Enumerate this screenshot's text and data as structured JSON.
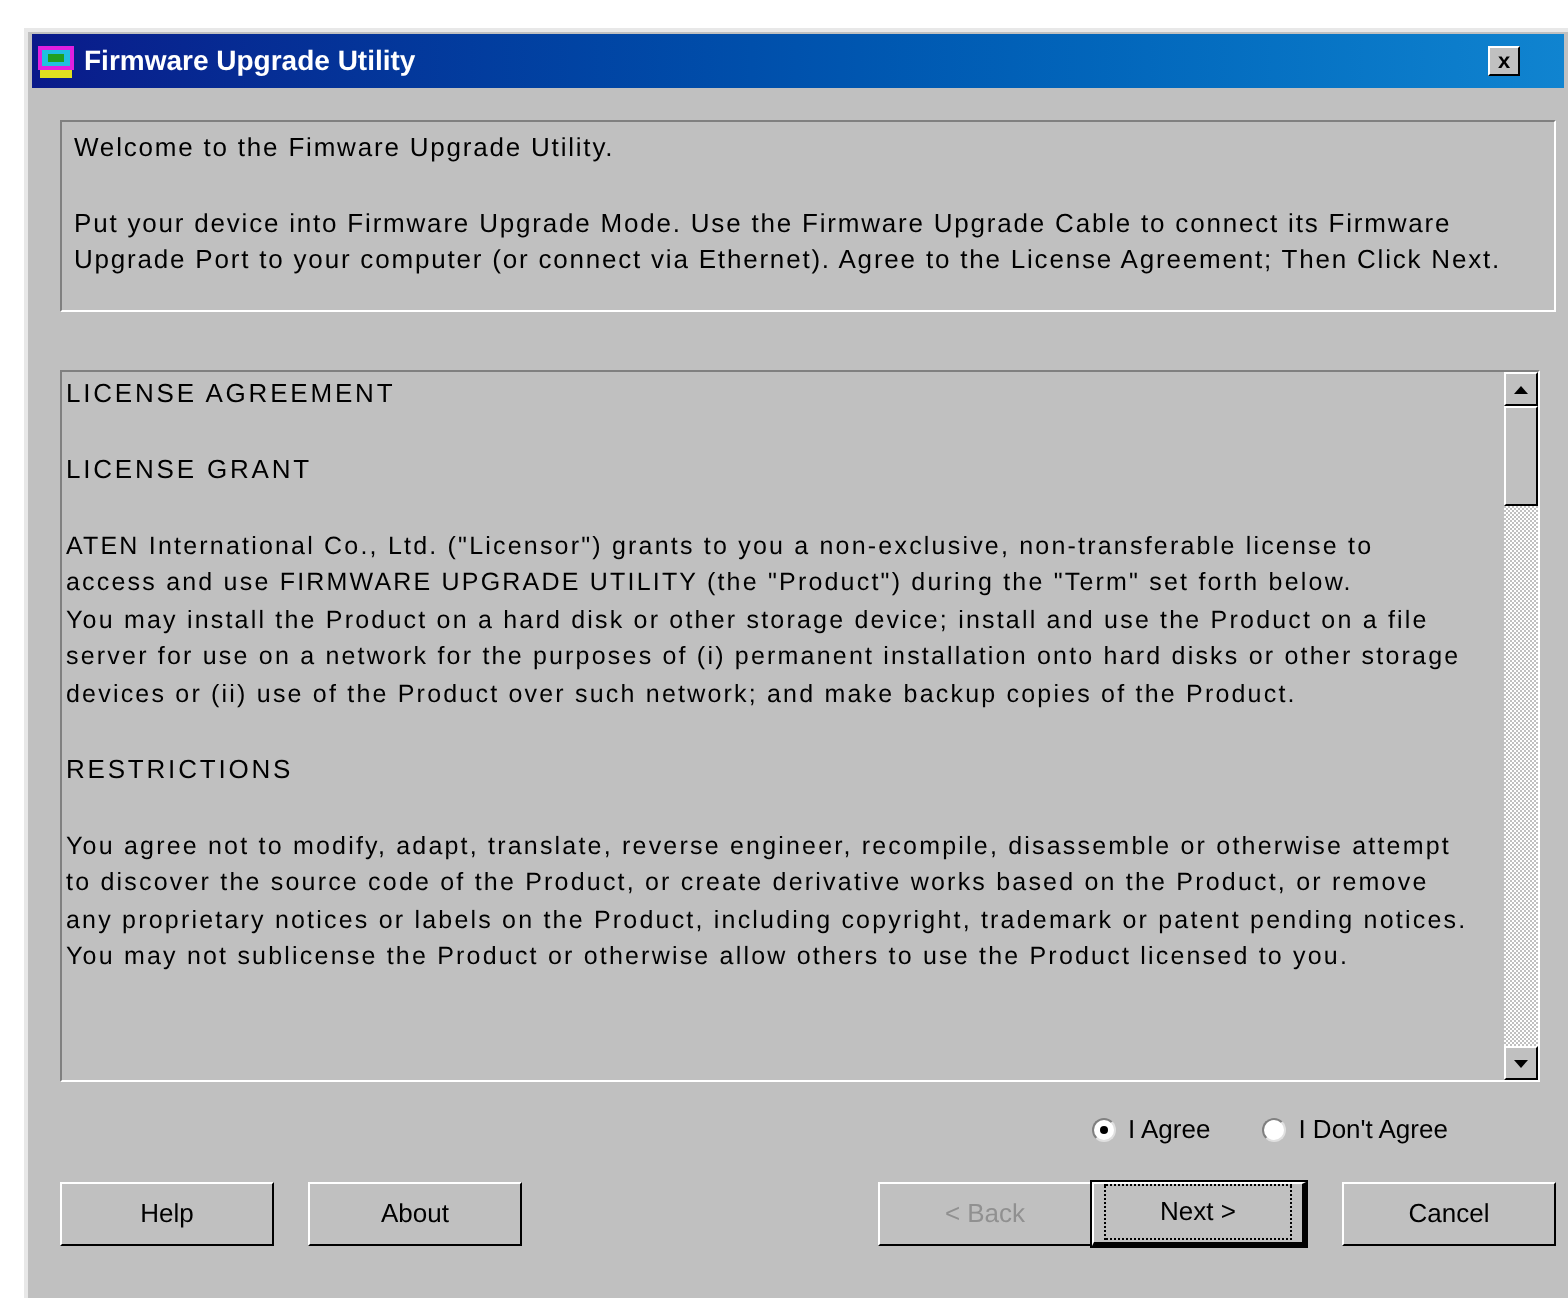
{
  "window": {
    "title": "Firmware Upgrade Utility",
    "close": "x"
  },
  "intro": {
    "paragraphs": [
      {
        "lines": [
          "Welcome to the Fimware Upgrade Utility."
        ]
      },
      {
        "lines": [
          "Put your device into Firmware Upgrade Mode. Use the Firmware Upgrade Cable to connect its Firmware",
          "Upgrade Port to your computer (or connect via Ethernet). Agree to the License Agreement; Then Click Next."
        ]
      }
    ]
  },
  "license": {
    "blocks": [
      {
        "kind": "heading",
        "lines": [
          "LICENSE AGREEMENT"
        ]
      },
      {
        "kind": "heading",
        "lines": [
          "LICENSE GRANT"
        ]
      },
      {
        "kind": "paragraph",
        "lines": [
          "ATEN International Co., Ltd. (\"Licensor\") grants to you a non-exclusive, non-transferable license to",
          "access and use FIRMWARE UPGRADE UTILITY (the \"Product\") during the \"Term\" set forth below.",
          "You may install the Product on a hard disk or other storage device; install and use the Product on a file",
          "server for use on a network for the purposes of (i) permanent installation onto hard disks or other storage",
          "devices or (ii) use of the Product over such network; and make backup copies of the Product."
        ]
      },
      {
        "kind": "heading",
        "lines": [
          "RESTRICTIONS"
        ]
      },
      {
        "kind": "paragraph",
        "lines": [
          "You agree not to modify, adapt, translate, reverse engineer, recompile, disassemble or otherwise attempt",
          "to discover the source code of the Product, or create derivative works based on the Product, or remove",
          "any proprietary notices or labels on the Product, including copyright, trademark or patent pending notices.",
          "You may not sublicense the Product or otherwise allow others to use the Product licensed to you."
        ]
      }
    ]
  },
  "agreement": [
    {
      "label": "I Agree",
      "selected": true
    },
    {
      "label": "I Don't Agree",
      "selected": false
    }
  ],
  "buttons_left": [
    {
      "label": "Help",
      "disabled": false,
      "focused": false
    },
    {
      "label": "About",
      "disabled": false,
      "focused": false
    }
  ],
  "buttons_right": [
    {
      "label": "< Back",
      "disabled": true,
      "focused": false
    },
    {
      "label": "Next >",
      "disabled": false,
      "focused": true
    },
    {
      "label": "Cancel",
      "disabled": false,
      "focused": false
    }
  ]
}
